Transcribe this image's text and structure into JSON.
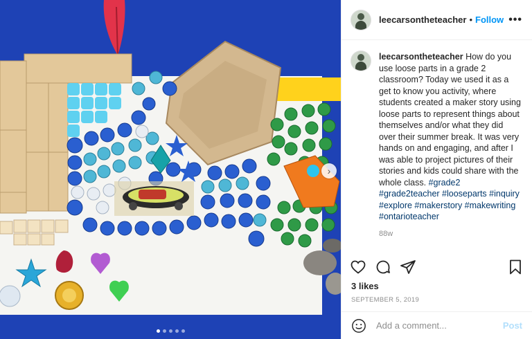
{
  "photo": {
    "description_icon": "loose-parts-photo",
    "carousel_dots": 5,
    "active_dot": 0,
    "next_icon": "chevron-right-icon"
  },
  "header": {
    "username": "leecarsontheteacher",
    "separator": "•",
    "follow_label": "Follow",
    "more_icon": "more-options-icon",
    "more_label": "•••"
  },
  "caption": {
    "username": "leecarsontheteacher",
    "text": "How do you use loose parts in a grade 2 classroom? Today we used it as a get to know you activity, where students created a maker story using loose parts to represent things about themselves and/or what they did over their summer break. It was very hands on and engaging, and after I was able to project pictures of their stories and kids could share with the whole class.",
    "hashtags": "#grade2 #grade2teacher #looseparts #inquiry #explore #makerstory #makewriting #ontarioteacher",
    "time_ago": "88w"
  },
  "actions": {
    "like_icon": "heart-icon",
    "comment_icon": "comment-icon",
    "share_icon": "share-icon",
    "save_icon": "bookmark-icon"
  },
  "likes": "3 likes",
  "date": "SEPTEMBER 5, 2019",
  "comment": {
    "emoji_icon": "emoji-icon",
    "placeholder": "Add a comment...",
    "post_label": "Post"
  },
  "colors": {
    "link_blue": "#0095f6",
    "hashtag_blue": "#00376b",
    "muted": "#8e8e8e",
    "post_disabled": "#b2dffc",
    "photo_blue": "#1d3fb0"
  }
}
